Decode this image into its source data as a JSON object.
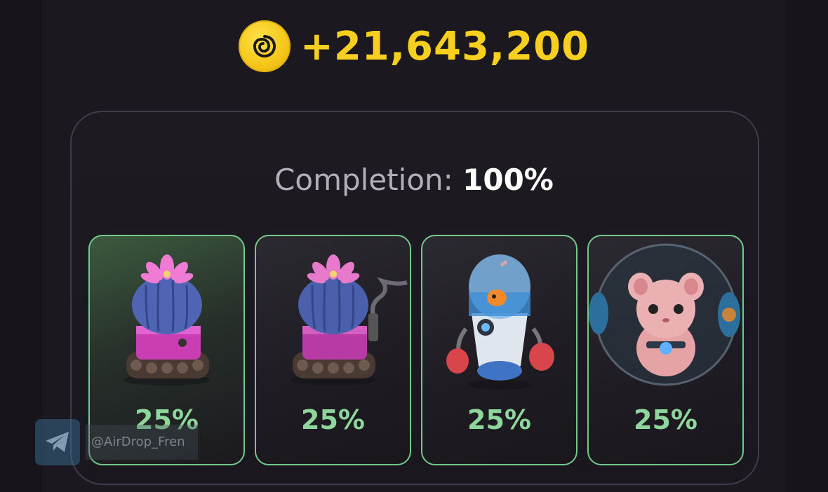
{
  "reward": {
    "icon": "hamster-coin-icon",
    "amount": "+21,643,200",
    "color": "#f7cf1e"
  },
  "completion": {
    "label": "Completion: ",
    "value": "100%"
  },
  "cards": [
    {
      "item": "cactus-tank",
      "percent": "25%"
    },
    {
      "item": "cactus-tank-smoking",
      "percent": "25%"
    },
    {
      "item": "fishbowl-robot-boxer",
      "percent": "25%"
    },
    {
      "item": "hamster-in-ball",
      "percent": "25%"
    }
  ],
  "watermark": {
    "icon": "telegram-icon",
    "text": "@AirDrop_Fren"
  },
  "colors": {
    "background": "#1c1820",
    "panel_border": "#433b4c",
    "card_border": "#74c98a",
    "percent_text": "#8ed69b"
  }
}
